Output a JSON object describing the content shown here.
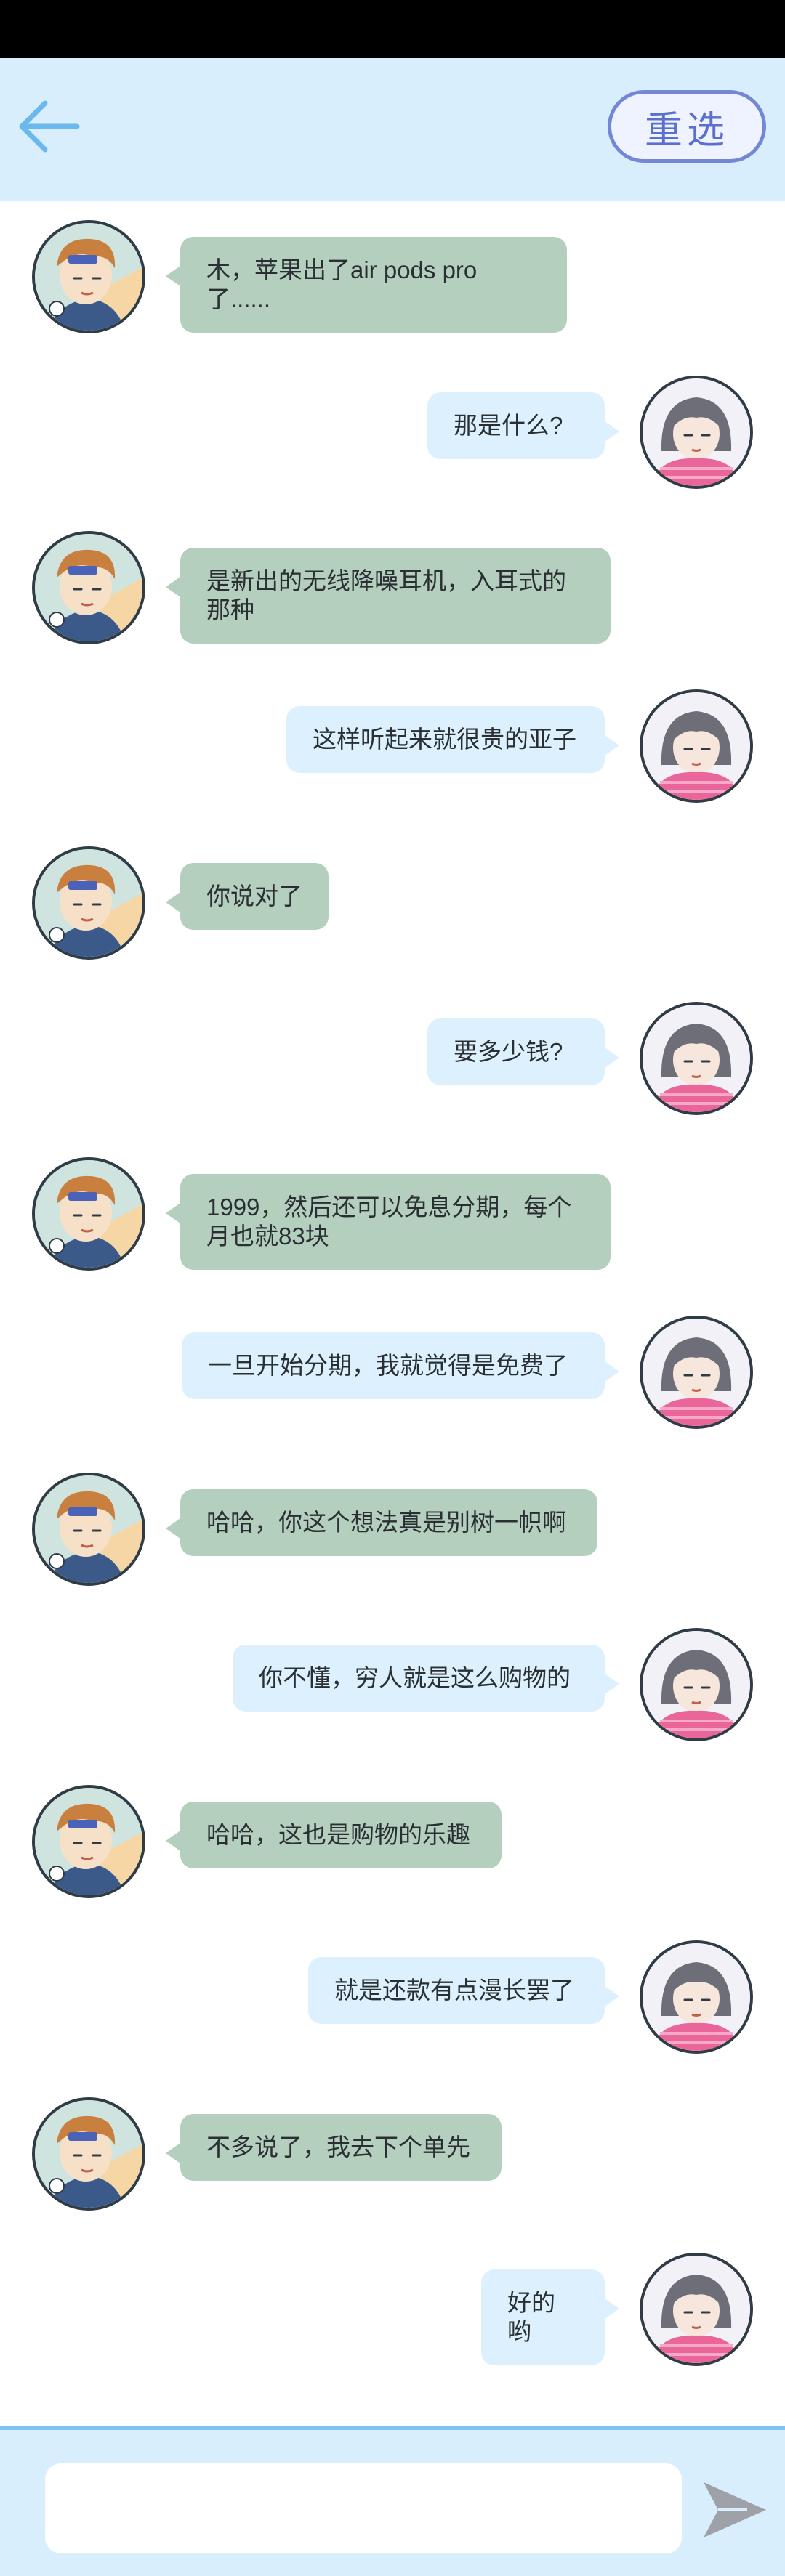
{
  "header": {
    "reselect_label": "重选"
  },
  "messages": [
    {
      "side": "left",
      "text": "木，苹果出了air pods pro了......"
    },
    {
      "side": "right",
      "text": "那是什么?"
    },
    {
      "side": "left",
      "text": "是新出的无线降噪耳机，入耳式的那种"
    },
    {
      "side": "right",
      "text": "这样听起来就很贵的亚子"
    },
    {
      "side": "left",
      "text": "你说对了"
    },
    {
      "side": "right",
      "text": "要多少钱?"
    },
    {
      "side": "left",
      "text": "1999，然后还可以免息分期，每个月也就83块"
    },
    {
      "side": "right",
      "text": "一旦开始分期，我就觉得是免费了"
    },
    {
      "side": "left",
      "text": "哈哈，你这个想法真是别树一帜啊"
    },
    {
      "side": "right",
      "text": "你不懂，穷人就是这么购物的"
    },
    {
      "side": "left",
      "text": "哈哈，这也是购物的乐趣"
    },
    {
      "side": "right",
      "text": "就是还款有点漫长罢了"
    },
    {
      "side": "left",
      "text": "不多说了，我去下个单先"
    },
    {
      "side": "right",
      "text": "好的哟"
    }
  ],
  "composer": {
    "placeholder": ""
  },
  "colors": {
    "header_bg": "#d8eefc",
    "left_bubble": "#b5cfbf",
    "right_bubble": "#dcf1fd",
    "accent": "#7486d6"
  },
  "icons": {
    "back": "arrow-left-icon",
    "send": "send-icon",
    "left_avatar": "boy-avatar",
    "right_avatar": "girl-avatar"
  }
}
